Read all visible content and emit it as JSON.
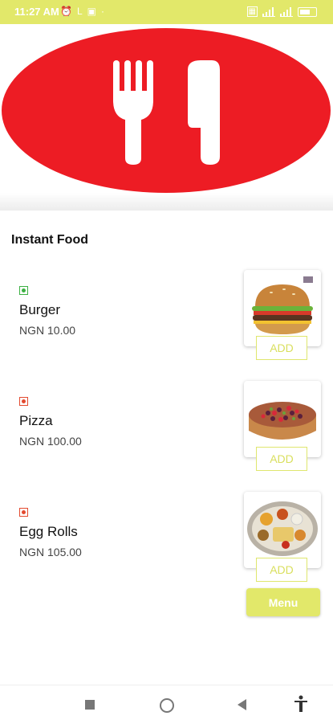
{
  "status_bar": {
    "time": "11:27 AM",
    "left_icons": [
      "alarm-icon",
      "l-icon",
      "app-icon",
      "dot-icon"
    ],
    "right_icons": [
      "sim-icon",
      "signal-icon",
      "signal-icon",
      "battery-icon"
    ]
  },
  "hero": {
    "logo": "fork-knife-icon",
    "logo_color": "#ed1c24"
  },
  "section": {
    "title": "Instant Food"
  },
  "items": [
    {
      "name": "Burger",
      "price": "NGN 10.00",
      "diet": "veg",
      "diet_color": "#3cb043",
      "image": "burger-image",
      "add_label": "ADD"
    },
    {
      "name": "Pizza",
      "price": "NGN 100.00",
      "diet": "non-veg",
      "diet_color": "#e34a2f",
      "image": "pizza-image",
      "add_label": "ADD"
    },
    {
      "name": "Egg Rolls",
      "price": "NGN 105.00",
      "diet": "non-veg",
      "diet_color": "#e34a2f",
      "image": "platter-image",
      "add_label": "ADD"
    }
  ],
  "menu_button": {
    "label": "Menu"
  },
  "colors": {
    "accent": "#e2e86a",
    "brand_red": "#ed1c24"
  },
  "nav_bar": [
    "recents-icon",
    "home-icon",
    "back-icon",
    "accessibility-icon"
  ]
}
